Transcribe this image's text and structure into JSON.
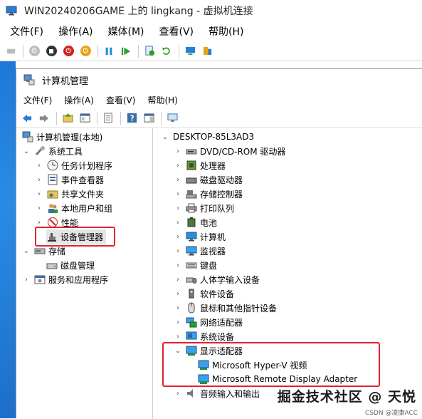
{
  "vm": {
    "title": "WIN20240206GAME 上的 lingkang - 虚拟机连接",
    "menu": [
      "文件(F)",
      "操作(A)",
      "媒体(M)",
      "查看(V)",
      "帮助(H)"
    ]
  },
  "cm": {
    "title": "计算机管理",
    "menu": [
      "文件(F)",
      "操作(A)",
      "查看(V)",
      "帮助(H)"
    ]
  },
  "left_tree": {
    "root": "计算机管理(本地)",
    "system_tools": "系统工具",
    "task_scheduler": "任务计划程序",
    "event_viewer": "事件查看器",
    "shared_folders": "共享文件夹",
    "local_users": "本地用户和组",
    "performance": "性能",
    "device_manager": "设备管理器",
    "storage": "存储",
    "disk_management": "磁盘管理",
    "services": "服务和应用程序"
  },
  "right_tree": {
    "computer": "DESKTOP-85L3AD3",
    "items": [
      "DVD/CD-ROM 驱动器",
      "处理器",
      "磁盘驱动器",
      "存储控制器",
      "打印队列",
      "电池",
      "计算机",
      "监视器",
      "键盘",
      "人体学输入设备",
      "软件设备",
      "鼠标和其他指针设备",
      "网络适配器",
      "系统设备"
    ],
    "display_adapters": "显示适配器",
    "display_children": [
      "Microsoft Hyper-V 视频",
      "Microsoft Remote Display Adapter"
    ],
    "partial_next": "音频输入和输出"
  },
  "watermark": "掘金技术社区 @ 天悦",
  "watermark_small": "CSDN @凌康ACC"
}
